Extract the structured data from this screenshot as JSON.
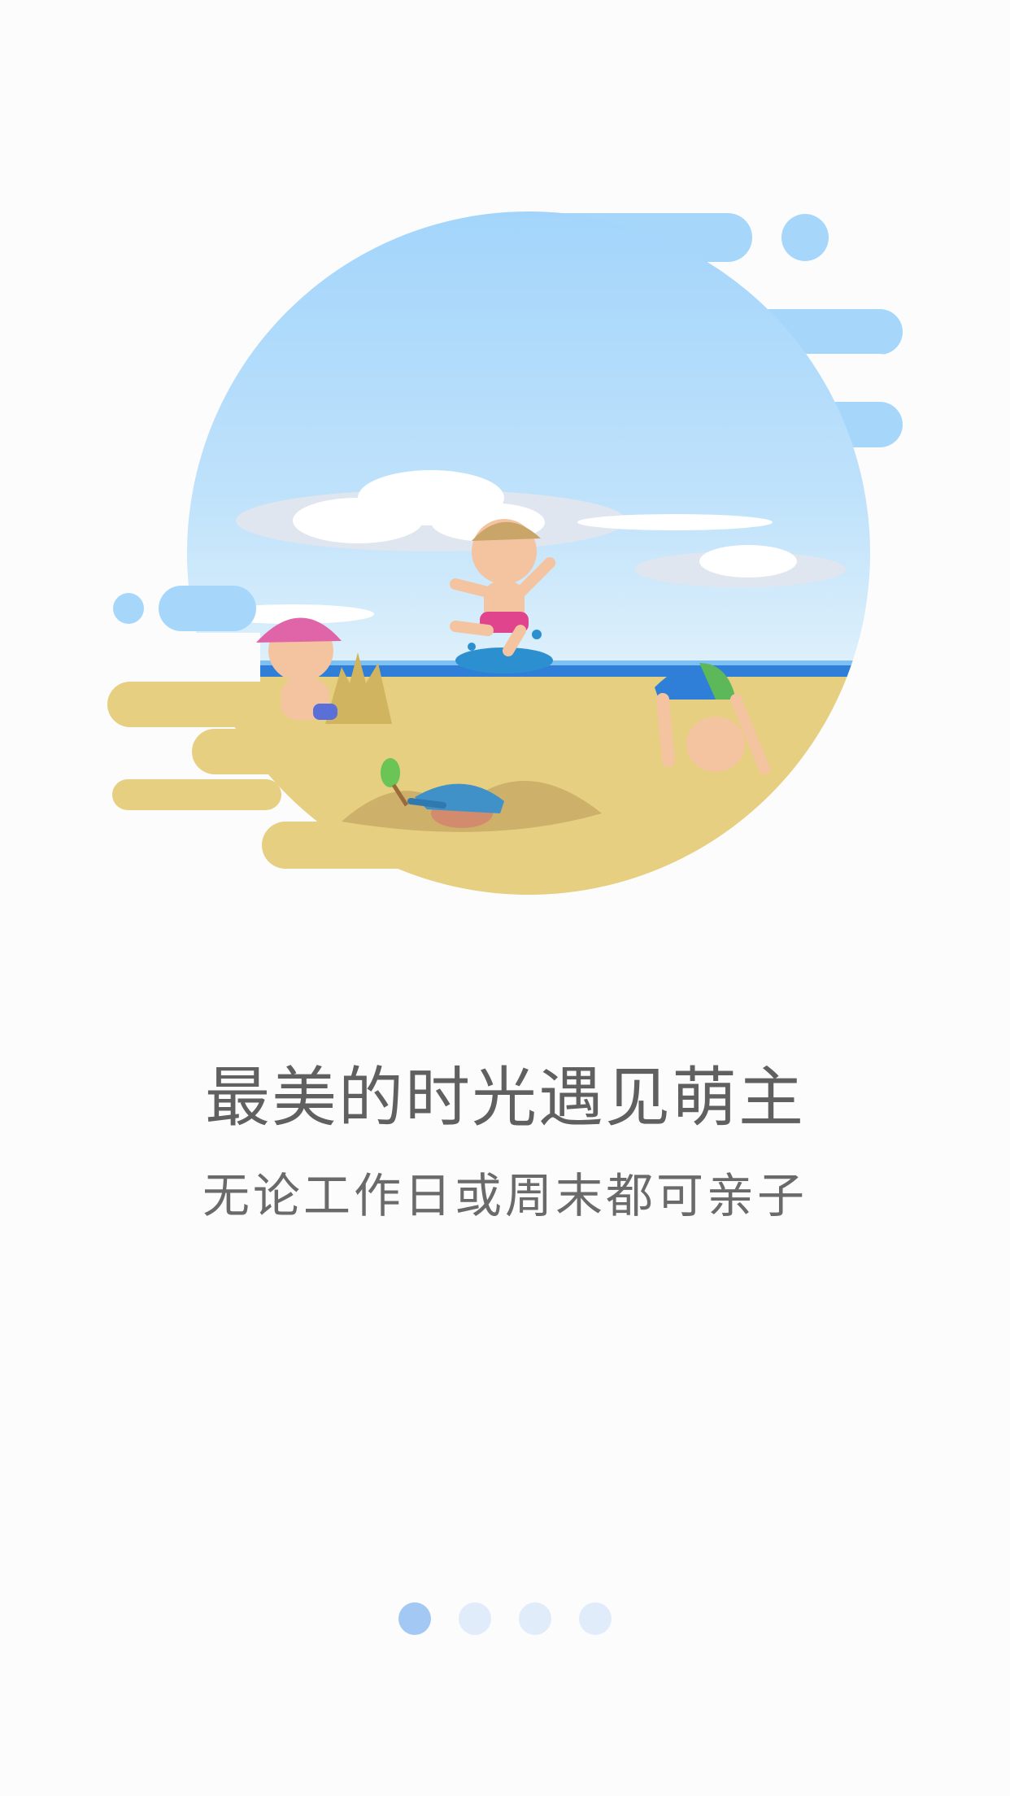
{
  "onboarding": {
    "title": "最美的时光遇见萌主",
    "subtitle": "无论工作日或周末都可亲子",
    "illustration_icon": "beach-kids-illustration-icon",
    "page_indicator": {
      "total": 4,
      "active_index": 0
    }
  },
  "colors": {
    "background": "#fcfcfd",
    "sky": "#a6d7fb",
    "sand": "#e6cf80",
    "sea": "#2f7fd8",
    "indicator_active": "#a4c8f4",
    "indicator_inactive": "#e1ecfa",
    "title_text": "#606060"
  }
}
